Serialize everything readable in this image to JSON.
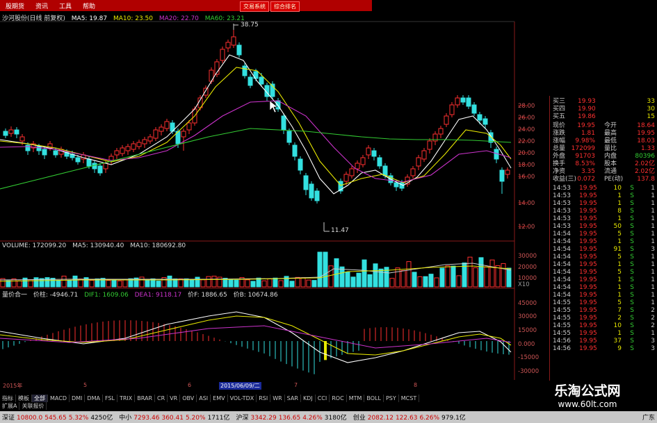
{
  "menu": [
    "股期货",
    "资讯",
    "工具",
    "帮助"
  ],
  "menu_center": [
    "交易系统",
    "综合排名"
  ],
  "main_header": {
    "title": "沙河股份(日线 前复权)",
    "ma5": "MA5: 19.87",
    "ma10": "MA10: 23.50",
    "ma20": "MA20: 22.70",
    "ma60": "MA60: 23.21"
  },
  "price_high": "38.75",
  "price_low": "11.47",
  "price_axis": [
    "28.00",
    "26.00",
    "24.00",
    "22.00",
    "20.00",
    "18.00",
    "16.00",
    "14.00",
    "12.00"
  ],
  "volume_header": {
    "label": "VOLUME: 172099.20",
    "ma5": "MA5: 130940.40",
    "ma10": "MA10: 180692.80"
  },
  "volume_axis": [
    "30000",
    "20000",
    "10000",
    "X10"
  ],
  "macd_header": {
    "label": "量价合一",
    "jz": "价柱: -4946.71",
    "dif": "DIF1: 1609.06",
    "dea": "DEA1: 9118.17",
    "jf": "价F: 1886.65",
    "jb": "价B: 10674.86"
  },
  "macd_axis": [
    "45000",
    "30000",
    "15000",
    "0.000",
    "-15000",
    "-30000"
  ],
  "date_axis": {
    "year": "2015年",
    "m1": "5",
    "m2": "6",
    "cursor": "2015/06/09/二",
    "m3": "7",
    "m4": "8"
  },
  "tabs_row1": [
    "指标",
    "模板",
    "全部",
    "MACD",
    "DMI",
    "DMA",
    "FSL",
    "TRIX",
    "BRAR",
    "CR",
    "VR",
    "OBV",
    "ASI",
    "EMV",
    "VOL-TDX",
    "RSI",
    "WR",
    "SAR",
    "KDJ",
    "CCI",
    "ROC",
    "MTM",
    "BOLL",
    "PSY",
    "MCST"
  ],
  "tabs_row2": [
    "扩展A",
    "关联报价"
  ],
  "quote": {
    "asks": [
      {
        "label": "买三",
        "price": "19.93",
        "vol": "33"
      },
      {
        "label": "买四",
        "price": "19.90",
        "vol": "30"
      },
      {
        "label": "买五",
        "price": "19.86",
        "vol": "15"
      }
    ],
    "stats": [
      {
        "l1": "现价",
        "v1": "19.95",
        "l2": "今开",
        "v2": "18.64"
      },
      {
        "l1": "涨跌",
        "v1": "1.81",
        "l2": "最高",
        "v2": "19.95"
      },
      {
        "l1": "涨幅",
        "v1": "9.98%",
        "l2": "最低",
        "v2": "18.03"
      },
      {
        "l1": "总量",
        "v1": "172099",
        "l2": "量比",
        "v2": "1.33"
      },
      {
        "l1": "外盘",
        "v1": "91703",
        "l2": "内盘",
        "v2": "80396"
      },
      {
        "l1": "换手",
        "v1": "8.53%",
        "l2": "股本",
        "v2": "2.02亿"
      },
      {
        "l1": "净资",
        "v1": "3.35",
        "l2": "流通",
        "v2": "2.02亿"
      },
      {
        "l1": "收益(三)",
        "v1": "0.072",
        "l2": "PE(动)",
        "v2": "137.8"
      }
    ],
    "ticks": [
      {
        "t": "14:53",
        "p": "19.95",
        "v": "10",
        "s": "S",
        "n": "1"
      },
      {
        "t": "14:53",
        "p": "19.95",
        "v": "1",
        "s": "S",
        "n": "1"
      },
      {
        "t": "14:53",
        "p": "19.95",
        "v": "1",
        "s": "S",
        "n": "1"
      },
      {
        "t": "14:53",
        "p": "19.95",
        "v": "8",
        "s": "S",
        "n": "1"
      },
      {
        "t": "14:53",
        "p": "19.95",
        "v": "1",
        "s": "S",
        "n": "1"
      },
      {
        "t": "14:53",
        "p": "19.95",
        "v": "50",
        "s": "S",
        "n": "1"
      },
      {
        "t": "14:54",
        "p": "19.95",
        "v": "5",
        "s": "S",
        "n": "1"
      },
      {
        "t": "14:54",
        "p": "19.95",
        "v": "1",
        "s": "S",
        "n": "1"
      },
      {
        "t": "14:54",
        "p": "19.95",
        "v": "91",
        "s": "S",
        "n": "3"
      },
      {
        "t": "14:54",
        "p": "19.95",
        "v": "5",
        "s": "S",
        "n": "1"
      },
      {
        "t": "14:54",
        "p": "19.95",
        "v": "1",
        "s": "S",
        "n": "1"
      },
      {
        "t": "14:54",
        "p": "19.95",
        "v": "5",
        "s": "S",
        "n": "1"
      },
      {
        "t": "14:54",
        "p": "19.95",
        "v": "1",
        "s": "S",
        "n": "1"
      },
      {
        "t": "14:54",
        "p": "19.95",
        "v": "1",
        "s": "S",
        "n": "1"
      },
      {
        "t": "14:54",
        "p": "19.95",
        "v": "1",
        "s": "S",
        "n": "1"
      },
      {
        "t": "14:55",
        "p": "19.95",
        "v": "5",
        "s": "S",
        "n": "1"
      },
      {
        "t": "14:55",
        "p": "19.95",
        "v": "7",
        "s": "S",
        "n": "2"
      },
      {
        "t": "14:55",
        "p": "19.95",
        "v": "2",
        "s": "S",
        "n": "2"
      },
      {
        "t": "14:55",
        "p": "19.95",
        "v": "10",
        "s": "S",
        "n": "2"
      },
      {
        "t": "14:55",
        "p": "19.95",
        "v": "1",
        "s": "S",
        "n": "1"
      },
      {
        "t": "14:56",
        "p": "19.95",
        "v": "37",
        "s": "S",
        "n": "3"
      },
      {
        "t": "14:56",
        "p": "19.95",
        "v": "9",
        "s": "S",
        "n": "3"
      }
    ]
  },
  "brand": {
    "name": "乐淘公式网",
    "url": "www.60lt.com"
  },
  "status": [
    {
      "label": "深证",
      "value": "10800.0",
      "chg": "545.65",
      "pct": "5.32%",
      "amt": "4250亿"
    },
    {
      "label": "中小",
      "value": "7293.46",
      "chg": "360.41",
      "pct": "5.20%",
      "amt": "1711亿"
    },
    {
      "label": "沪深",
      "value": "3342.29",
      "chg": "136.65",
      "pct": "4.26%",
      "amt": "3180亿"
    },
    {
      "label": "创业",
      "value": "2082.12",
      "chg": "122.63",
      "pct": "6.26%",
      "amt": "979.1亿"
    }
  ],
  "status_tail": "广东",
  "colors": {
    "up": "#ff3030",
    "down": "#33e0e0",
    "ma5": "#ffffff",
    "ma10": "#e8e800",
    "ma20": "#cc33cc",
    "ma60": "#33cc33",
    "axis": "#a01010"
  }
}
